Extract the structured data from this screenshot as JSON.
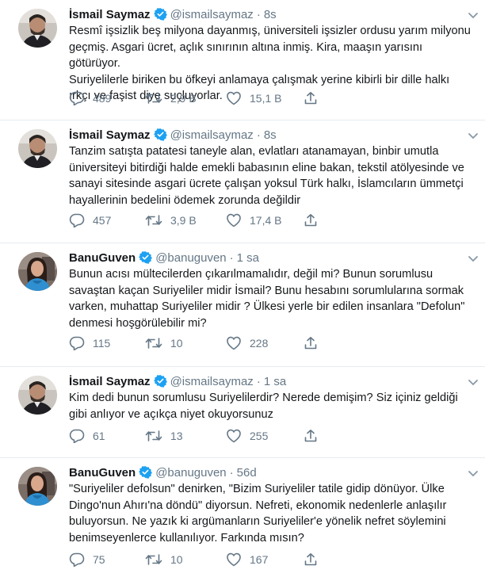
{
  "colors": {
    "text": "#14171a",
    "secondary": "#657786",
    "verified": "#1da1f2",
    "divider": "#e6ecf0"
  },
  "icons": {
    "reply": "comment-bubble-icon",
    "retweet": "retweet-icon",
    "like": "heart-icon",
    "share": "share-upload-icon",
    "menu": "chevron-down-icon",
    "verified": "verified-badge-icon"
  },
  "tweets": [
    {
      "name": "İsmail Saymaz",
      "verified": true,
      "handle": "@ismailsaymaz",
      "separator": "·",
      "time": "8s",
      "text": "Resmî işsizlik beş milyona dayanmış, üniversiteli işsizler ordusu yarım milyonu\ngeçmiş. Asgari ücret, açlık sınırının altına inmiş. Kira, maaşın yarısını götürüyor.\nSuriyelilerle biriken bu öfkeyi anlamaya çalışmak yerine kibirli bir dille halkı\nırkçı ve faşist diye suçluyorlar.",
      "replies": "489",
      "retweets": "2,9 B",
      "likes": "15,1 B"
    },
    {
      "name": "İsmail Saymaz",
      "verified": true,
      "handle": "@ismailsaymaz",
      "separator": "·",
      "time": "8s",
      "text": "Tanzim satışta patatesi taneyle alan, evlatları atanamayan, binbir umutla\nüniversiteyi bitirdiği halde emekli babasının eline bakan, tekstil atölyesinde ve\nsanayi sitesinde asgari ücrete çalışan yoksul Türk halkı, İslamcıların ümmetçi\nhayallerinin bedelini ödemek zorunda değildir",
      "replies": "457",
      "retweets": "3,9 B",
      "likes": "17,4 B"
    },
    {
      "name": "BanuGuven",
      "verified": true,
      "handle": "@banuguven",
      "separator": "·",
      "time": "1 sa",
      "text": "Bunun acısı mültecilerden çıkarılmamalıdır, değil mi? Bunun sorumlusu\nsavaştan kaçan Suriyeliler midir İsmail? Bunu hesabını sorumlularına sormak\nvarken, muhattap Suriyeliler midir ? Ülkesi yerle bir edilen insanlara \"Defolun\"\ndenmesi hoşgörülebilir mi?",
      "replies": "115",
      "retweets": "10",
      "likes": "228"
    },
    {
      "name": "İsmail Saymaz",
      "verified": true,
      "handle": "@ismailsaymaz",
      "separator": "·",
      "time": "1 sa",
      "text": "Kim dedi bunun sorumlusu Suriyelilerdir? Nerede demişim? Siz içiniz geldiği\ngibi anlıyor ve açıkça niyet okuyorsunuz",
      "replies": "61",
      "retweets": "13",
      "likes": "255"
    },
    {
      "name": "BanuGuven",
      "verified": true,
      "handle": "@banuguven",
      "separator": "·",
      "time": "56d",
      "text": "\"Suriyeliler defolsun\" denirken, \"Bizim Suriyeliler tatile gidip dönüyor. Ülke\nDingo'nun Ahırı'na döndü\" diyorsun. Nefreti, ekonomik nedenlerle anlaşılır\nbuluyorsun. Ne yazık ki argümanların Suriyeliler'e yönelik nefret söylemini\nbenimseyenlerce kullanılıyor. Farkında mısın?",
      "replies": "75",
      "retweets": "10",
      "likes": "167"
    }
  ]
}
